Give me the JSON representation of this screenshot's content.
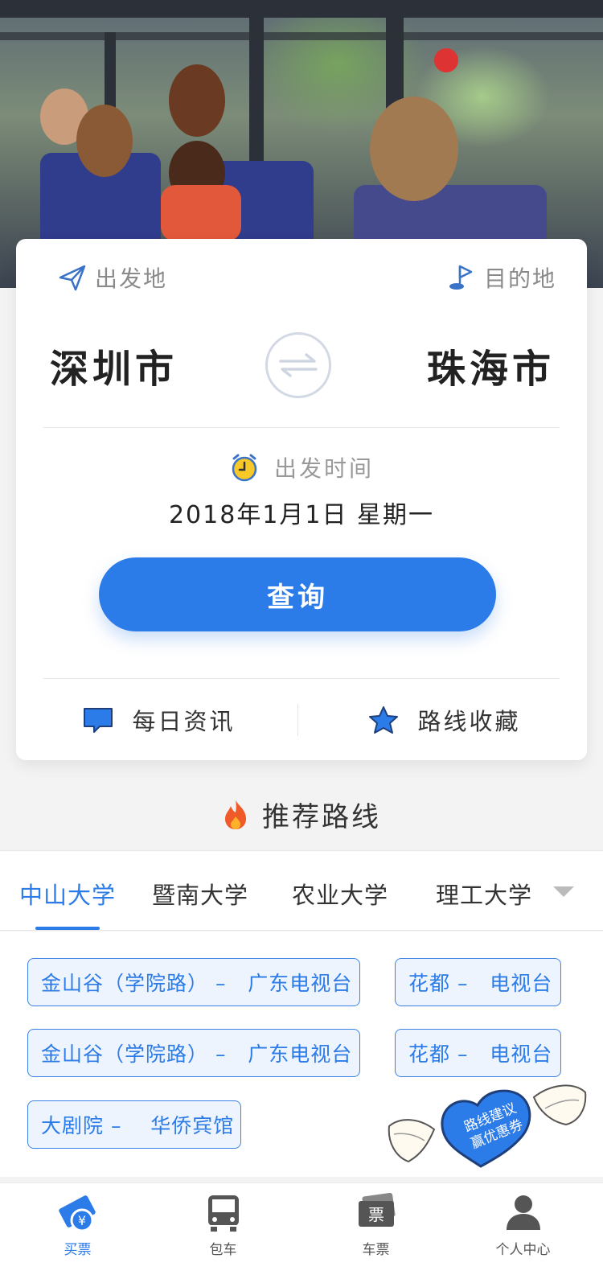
{
  "search": {
    "from_label": "出发地",
    "to_label": "目的地",
    "from_city": "深圳市",
    "to_city": "珠海市",
    "time_label": "出发时间",
    "date": "2018年1月1日 星期一",
    "query_button": "查询",
    "news_label": "每日资讯",
    "favorites_label": "路线收藏"
  },
  "recommend": {
    "title": "推荐路线",
    "tabs": [
      {
        "label": "中山大学",
        "active": true
      },
      {
        "label": "暨南大学",
        "active": false
      },
      {
        "label": "农业大学",
        "active": false
      },
      {
        "label": "理工大学",
        "active": false
      }
    ],
    "routes": [
      "金山谷（学院路） –   广东电视台",
      "花都 –   电视台",
      "金山谷（学院路） –   广东电视台",
      "花都 –   电视台",
      "大剧院 –    华侨宾馆"
    ],
    "promo": {
      "line1": "路线建议",
      "line2": "赢优惠券"
    }
  },
  "tabbar": {
    "items": [
      {
        "label": "买票",
        "icon": "ticket-buy-icon",
        "active": true
      },
      {
        "label": "包车",
        "icon": "bus-icon",
        "active": false
      },
      {
        "label": "车票",
        "icon": "tickets-icon",
        "active": false
      },
      {
        "label": "个人中心",
        "icon": "person-icon",
        "active": false
      }
    ]
  },
  "colors": {
    "accent": "#2b7be9",
    "chip_bg": "#eef4fd",
    "page_bg": "#f3f3f3"
  }
}
